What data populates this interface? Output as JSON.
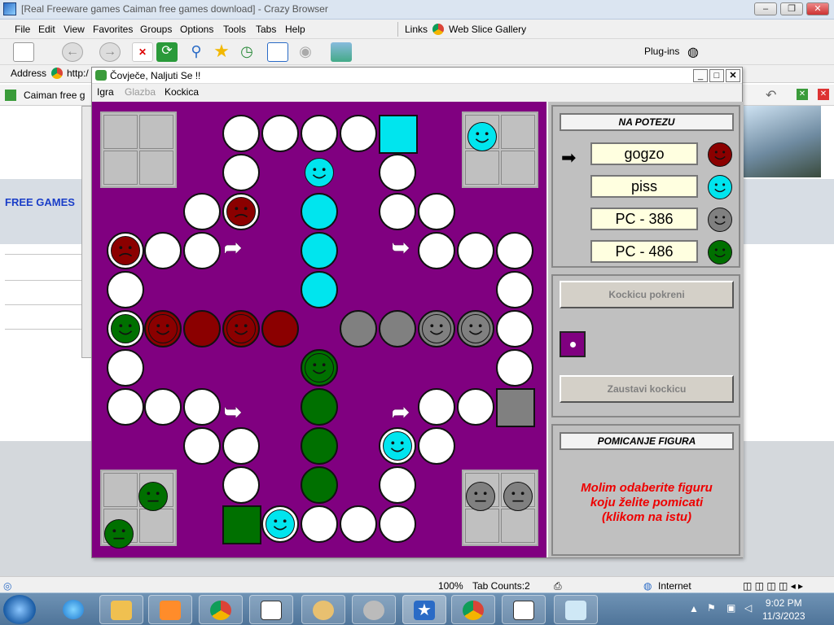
{
  "browser": {
    "title": "[Real Freeware games Caiman free games download] - Crazy Browser",
    "menu": [
      "File",
      "Edit",
      "View",
      "Favorites",
      "Groups",
      "Options",
      "Tools",
      "Tabs",
      "Help"
    ],
    "links_label": "Links",
    "web_slice": "Web Slice Gallery",
    "plugins": "Plug-ins",
    "address_label": "Address",
    "address_value": "http:/",
    "tab_label": "Caiman free g"
  },
  "page": {
    "free_games": "FREE GAMES"
  },
  "game": {
    "title": "Čovječe, Naljuti Se !!",
    "menu": [
      "Igra",
      "Glazba",
      "Kockica"
    ],
    "turn_title": "NA POTEZU",
    "players": [
      {
        "name": "gogzo",
        "color": "#8b0000"
      },
      {
        "name": "piss",
        "color": "#00e5ee"
      },
      {
        "name": "PC - 386",
        "color": "#808080"
      },
      {
        "name": "PC - 486",
        "color": "#007000"
      }
    ],
    "dice_button": "Kockicu pokreni",
    "stop_button": "Zaustavi kockicu",
    "dice_value": 1,
    "move_title": "POMICANJE FIGURA",
    "message_1": "Molim odaberite figuru",
    "message_2": "koju želite pomicati",
    "message_3": "(klikom na istu)",
    "colors": {
      "red": "#8b0000",
      "cyan": "#00e5ee",
      "grey": "#808080",
      "green": "#007000",
      "board": "#800080"
    }
  },
  "status": {
    "zoom": "100%",
    "tab_counts": "Tab Counts:2",
    "zone": "Internet"
  },
  "clock": {
    "time": "9:02 PM",
    "date": "11/3/2023"
  }
}
